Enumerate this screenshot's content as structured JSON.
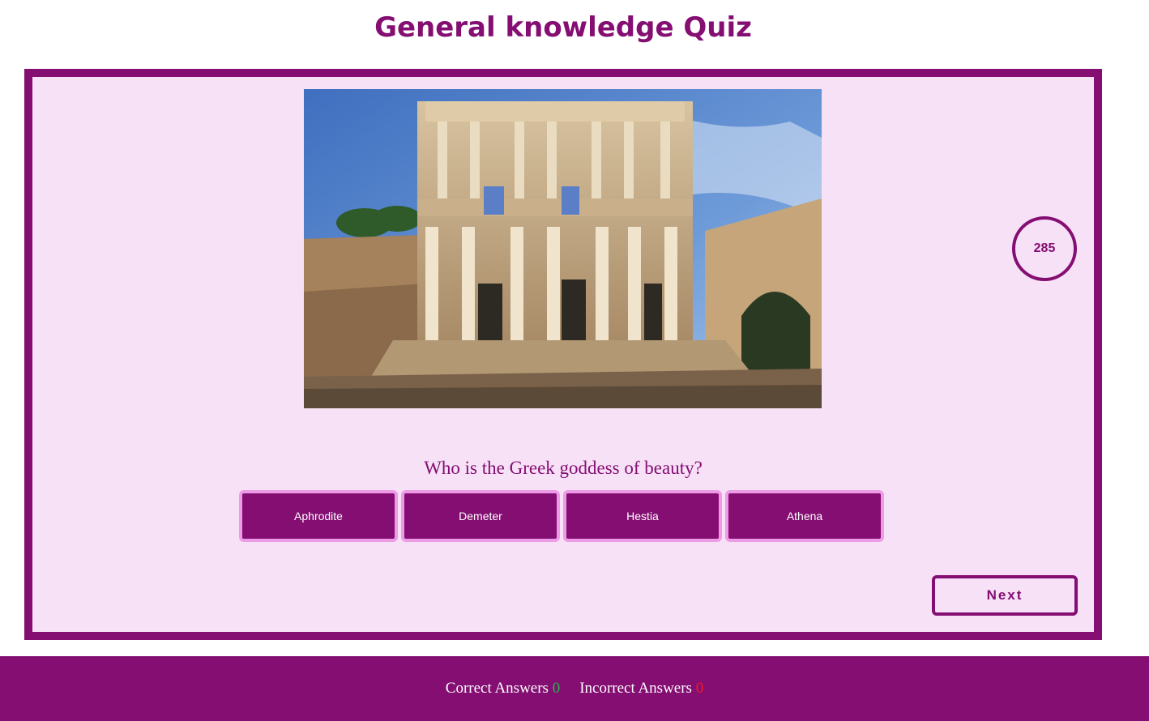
{
  "header": {
    "title": "General knowledge Quiz"
  },
  "quiz": {
    "image_subject": "ancient library ruins photo",
    "timer": "285",
    "question": "Who is the Greek goddess of beauty?",
    "answers": [
      "Aphrodite",
      "Demeter",
      "Hestia",
      "Athena"
    ],
    "next_label": "Next"
  },
  "footer": {
    "correct_label": "Correct Answers",
    "correct_count": "0",
    "incorrect_label": "Incorrect Answers",
    "incorrect_count": "0"
  },
  "colors": {
    "primary": "#840e72",
    "panel_background": "#f7e1f7",
    "answer_border": "#ee9be6",
    "correct": "#2bb24c",
    "incorrect": "#ff1a1a"
  }
}
